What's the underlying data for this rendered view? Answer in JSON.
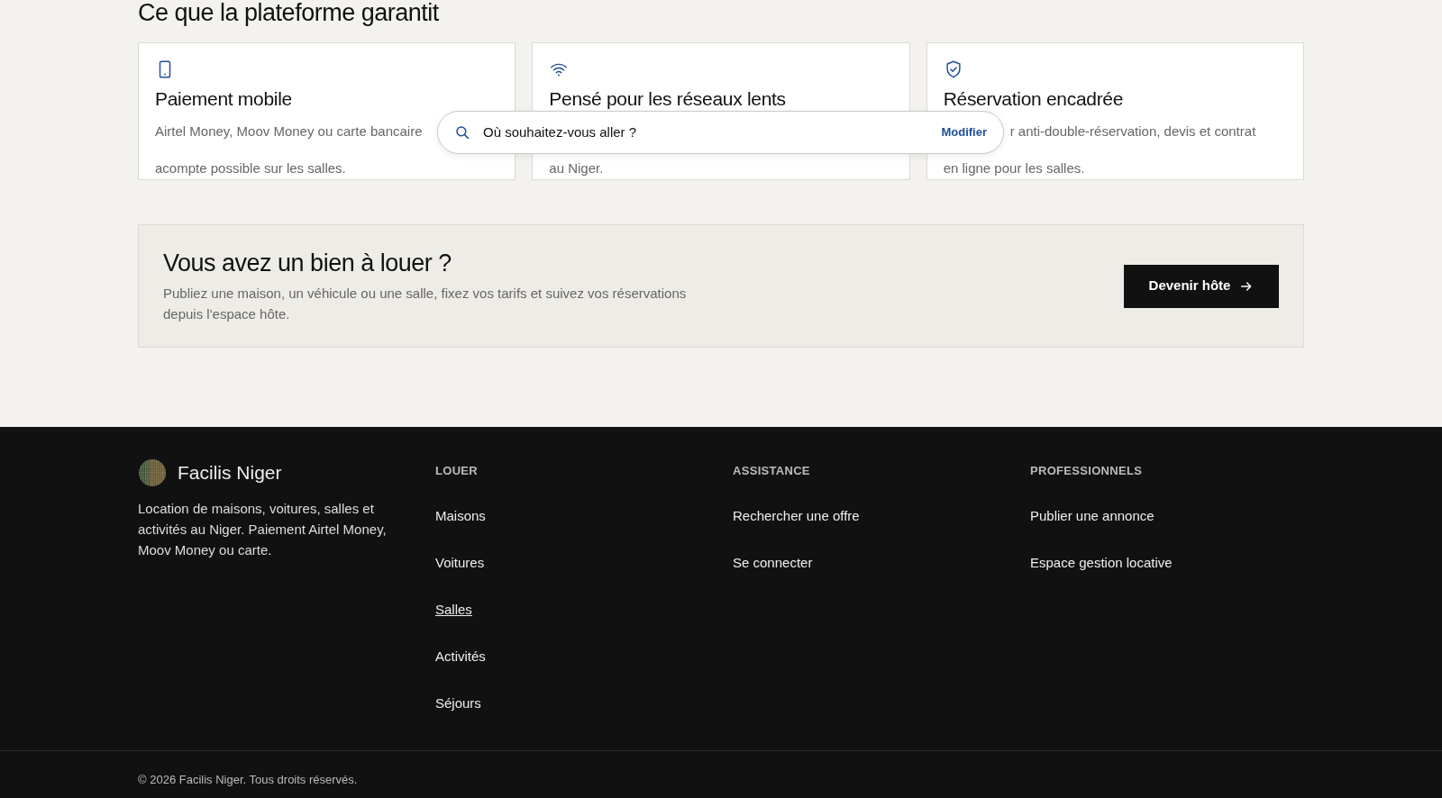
{
  "section_title": "Ce que la plateforme garantit",
  "features": [
    {
      "kind": "phone",
      "title": "Paiement mobile",
      "lines": [
        "Airtel Money, Moov Money ou carte bancaire",
        "acompte possible sur les salles."
      ]
    },
    {
      "kind": "wifi",
      "title": "Pensé pour les réseaux lents",
      "lines": [
        "au Niger."
      ]
    },
    {
      "kind": "shield",
      "title": "Réservation encadrée",
      "lines": [
        "r anti-double-réservation, devis et contrat",
        "en ligne pour les salles."
      ]
    }
  ],
  "search": {
    "placeholder": "Où souhaitez-vous aller ?",
    "action": "Modifier"
  },
  "host_banner": {
    "title": "Vous avez un bien à louer ?",
    "text": "Publiez une maison, un véhicule ou une salle, fixez vos tarifs et suivez vos réservations depuis l'espace hôte.",
    "button": "Devenir hôte"
  },
  "footer": {
    "brand": "Facilis Niger",
    "description": "Location de maisons, voitures, salles et activités au Niger. Paiement Airtel Money, Moov Money ou carte.",
    "columns": [
      {
        "heading": "LOUER",
        "links": [
          {
            "label": "Maisons",
            "selected": false
          },
          {
            "label": "Voitures",
            "selected": false
          },
          {
            "label": "Salles",
            "selected": true
          },
          {
            "label": "Activités",
            "selected": false
          },
          {
            "label": "Séjours",
            "selected": false
          }
        ]
      },
      {
        "heading": "ASSISTANCE",
        "links": [
          {
            "label": "Rechercher une offre",
            "selected": false
          },
          {
            "label": "Se connecter",
            "selected": false
          }
        ]
      },
      {
        "heading": "PROFESSIONNELS",
        "links": [
          {
            "label": "Publier une annonce",
            "selected": false
          },
          {
            "label": "Espace gestion locative",
            "selected": false
          }
        ]
      }
    ],
    "copyright": "© 2026 Facilis Niger. Tous droits réservés."
  }
}
